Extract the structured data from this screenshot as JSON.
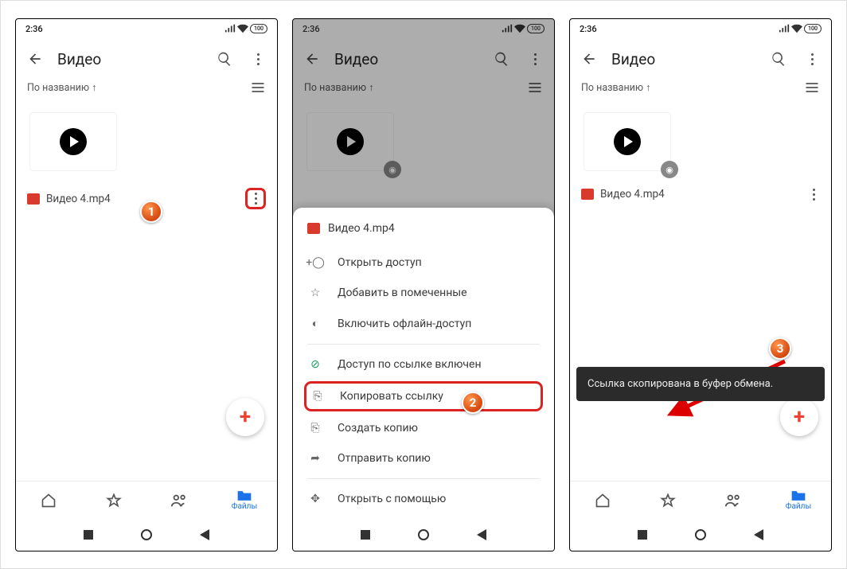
{
  "status": {
    "time": "2:36",
    "battery": "100"
  },
  "toolbar": {
    "title": "Видео"
  },
  "sort": {
    "label": "По названию",
    "dir": "↑"
  },
  "file": {
    "name": "Видео 4.mp4"
  },
  "tabs": {
    "home": "",
    "starred": "",
    "shared": "",
    "files": "Файлы"
  },
  "sheet": {
    "filename": "Видео 4.mp4",
    "items": {
      "share": "Открыть доступ",
      "star": "Добавить в помеченные",
      "offline": "Включить офлайн-доступ",
      "link_on": "Доступ по ссылке включен",
      "copy_link": "Копировать ссылку",
      "make_copy": "Создать копию",
      "send_copy": "Отправить копию",
      "open_with": "Открыть с помощью"
    }
  },
  "toast": {
    "text": "Ссылка скопирована в буфер обмена."
  },
  "callouts": {
    "one": "1",
    "two": "2",
    "three": "3"
  }
}
